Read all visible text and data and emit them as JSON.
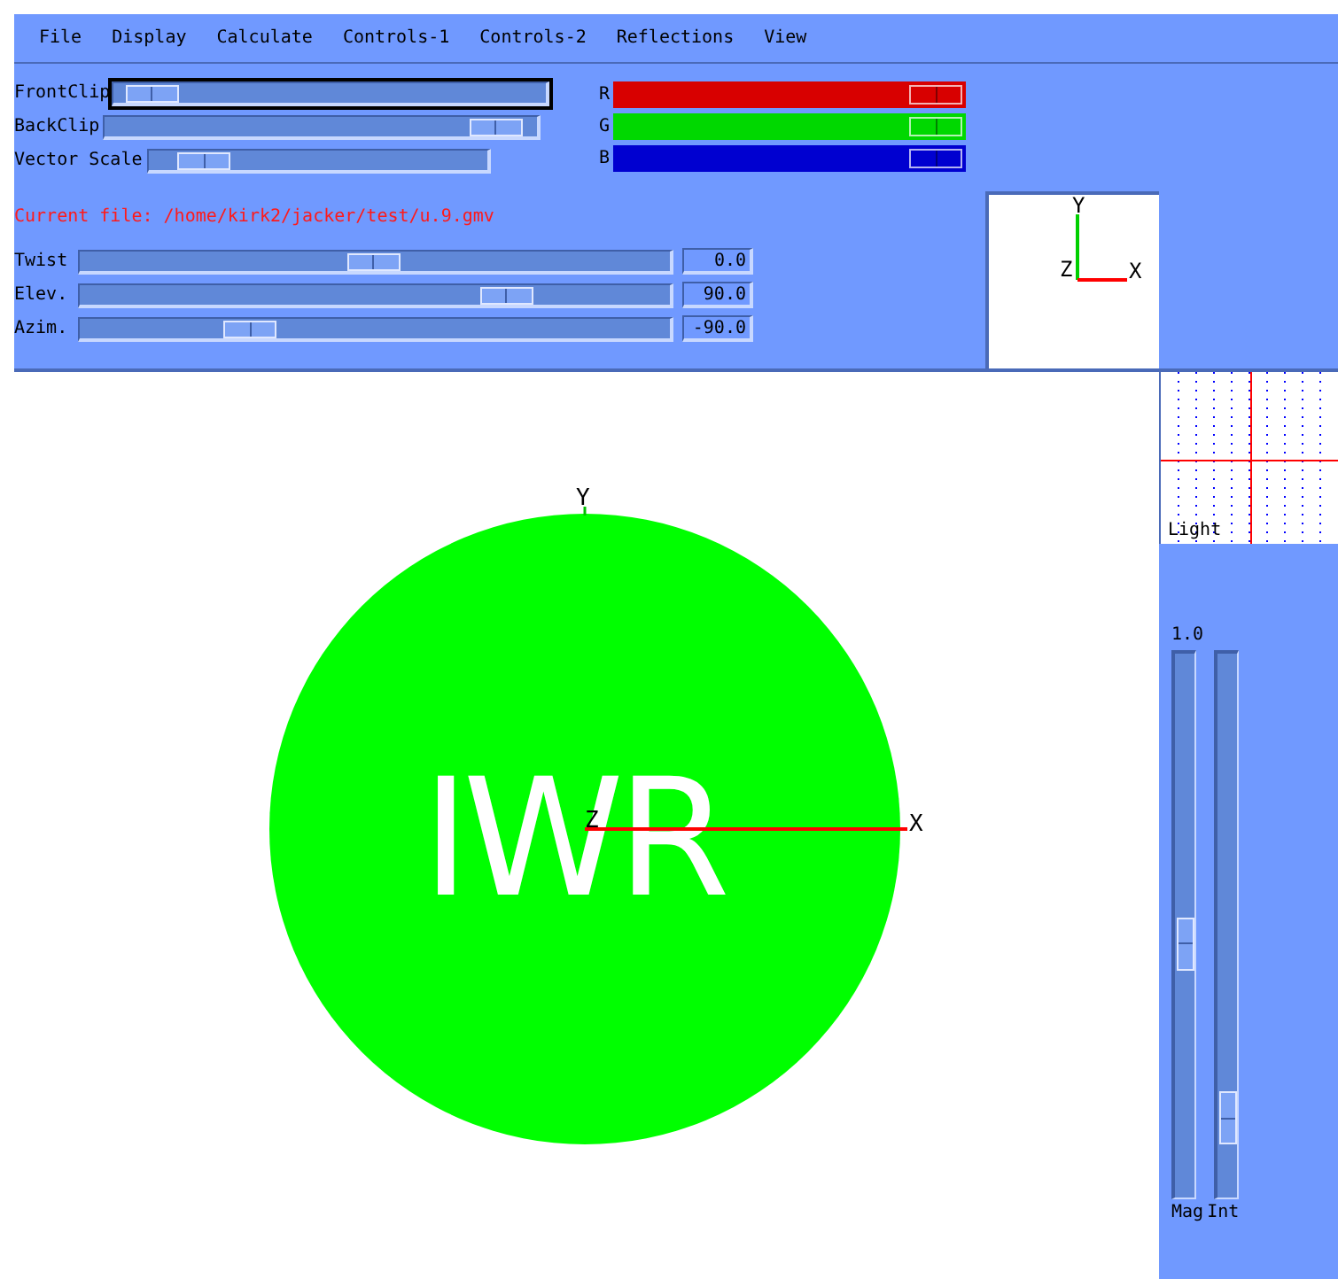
{
  "menu": [
    "File",
    "Display",
    "Calculate",
    "Controls-1",
    "Controls-2",
    "Reflections",
    "View"
  ],
  "clip_sliders": [
    {
      "label": "FrontClip",
      "level": 0.03,
      "focused": true
    },
    {
      "label": "BackClip",
      "focused": false
    },
    {
      "label": "Vector Scale",
      "level": 0.1,
      "focused": false
    }
  ],
  "color_sliders": [
    {
      "label": "R",
      "color": "#d80000"
    },
    {
      "label": "G",
      "color": "#00d800"
    },
    {
      "label": "B",
      "color": "#0000d0"
    }
  ],
  "current_file": "Current file: /home/kirk2/jacker/test/u.9.gmv",
  "view_sliders": [
    {
      "label": "Twist",
      "level": 0.5,
      "value": "0.0"
    },
    {
      "label": "Elev.",
      "value": "90.0"
    },
    {
      "label": "Azim.",
      "level": 0.27,
      "value": "-90.0"
    }
  ],
  "axes_box": {
    "y": "Y",
    "z": "Z",
    "x": "X"
  },
  "viewport": {
    "logo": "IWR",
    "y": "Y",
    "z": "Z",
    "x": "X"
  },
  "light_panel": {
    "label": "Light"
  },
  "vertical_sliders": {
    "reading": "1.0",
    "items": [
      {
        "label": "Mag",
        "level": 0.46
      },
      {
        "label": "Int",
        "level": 0.1
      }
    ]
  }
}
